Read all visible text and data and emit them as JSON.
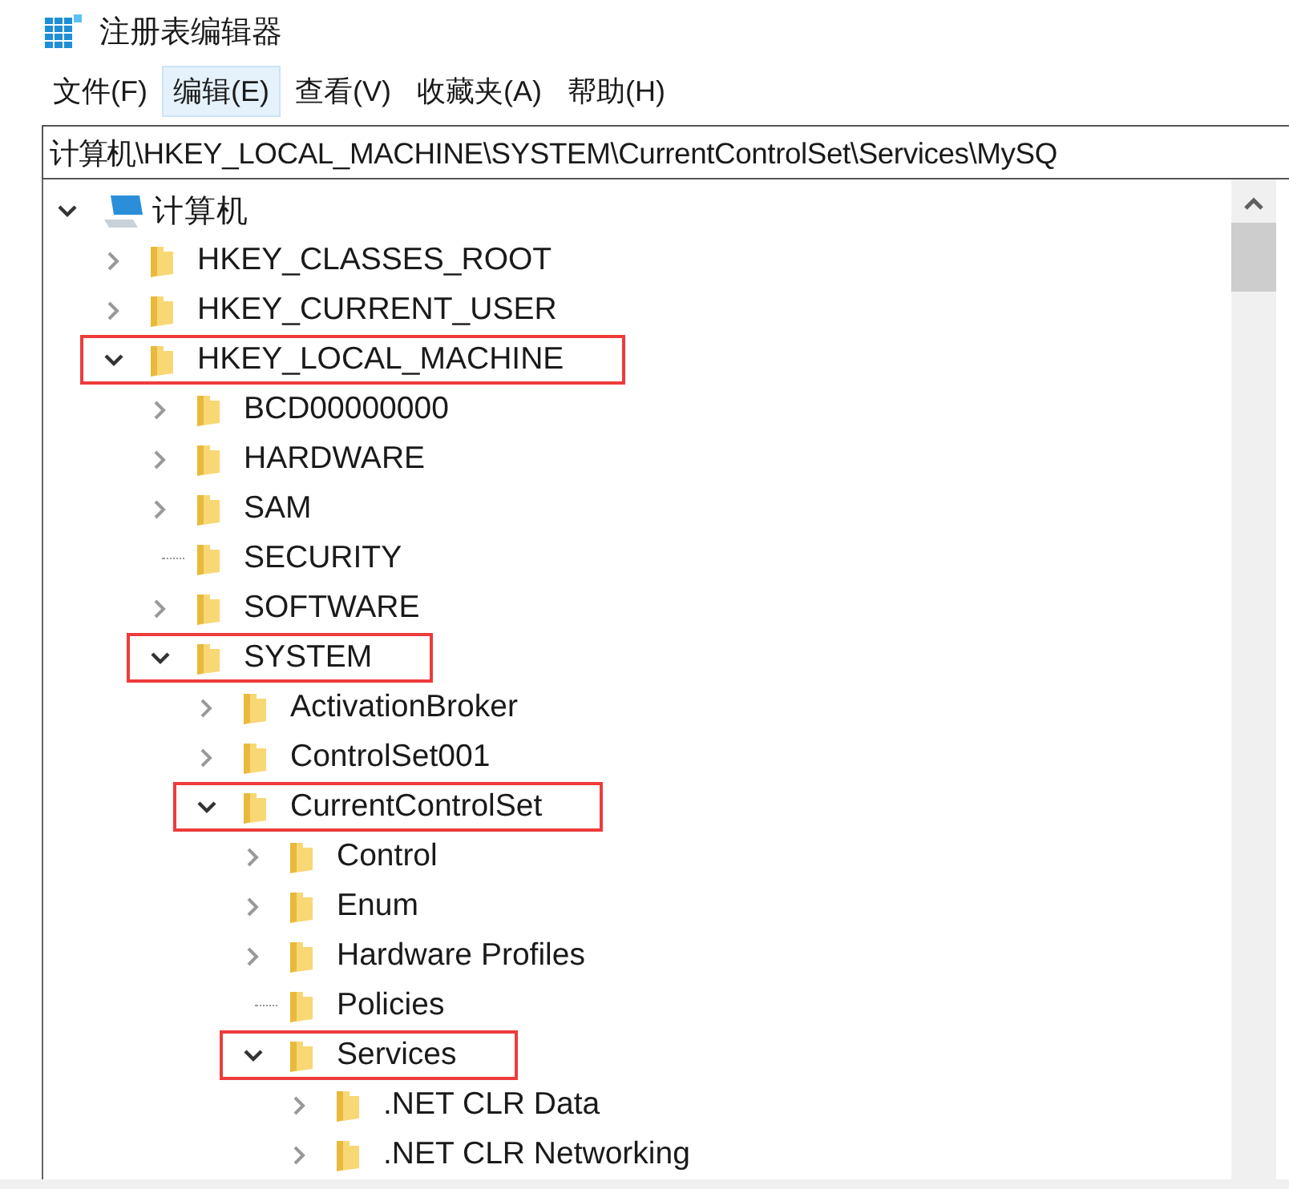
{
  "window": {
    "title": "注册表编辑器"
  },
  "menu": [
    {
      "label": "文件(F)",
      "selected": false
    },
    {
      "label": "编辑(E)",
      "selected": true
    },
    {
      "label": "查看(V)",
      "selected": false
    },
    {
      "label": "收藏夹(A)",
      "selected": false
    },
    {
      "label": "帮助(H)",
      "selected": false
    }
  ],
  "address": {
    "value": "计算机\\HKEY_LOCAL_MACHINE\\SYSTEM\\CurrentControlSet\\Services\\MySQ"
  },
  "tree": {
    "label": "计算机",
    "kind": "computer",
    "expandable": true,
    "expanded": true,
    "highlighted": false,
    "children": [
      {
        "label": "HKEY_CLASSES_ROOT",
        "kind": "folder",
        "expandable": true,
        "expanded": false,
        "highlighted": false
      },
      {
        "label": "HKEY_CURRENT_USER",
        "kind": "folder",
        "expandable": true,
        "expanded": false,
        "highlighted": false
      },
      {
        "label": "HKEY_LOCAL_MACHINE",
        "kind": "folder",
        "expandable": true,
        "expanded": true,
        "highlighted": true,
        "children": [
          {
            "label": "BCD00000000",
            "kind": "folder",
            "expandable": true,
            "expanded": false,
            "highlighted": false
          },
          {
            "label": "HARDWARE",
            "kind": "folder",
            "expandable": true,
            "expanded": false,
            "highlighted": false
          },
          {
            "label": "SAM",
            "kind": "folder",
            "expandable": true,
            "expanded": false,
            "highlighted": false
          },
          {
            "label": "SECURITY",
            "kind": "folder",
            "expandable": false,
            "expanded": false,
            "highlighted": false
          },
          {
            "label": "SOFTWARE",
            "kind": "folder",
            "expandable": true,
            "expanded": false,
            "highlighted": false
          },
          {
            "label": "SYSTEM",
            "kind": "folder",
            "expandable": true,
            "expanded": true,
            "highlighted": true,
            "children": [
              {
                "label": "ActivationBroker",
                "kind": "folder",
                "expandable": true,
                "expanded": false,
                "highlighted": false
              },
              {
                "label": "ControlSet001",
                "kind": "folder",
                "expandable": true,
                "expanded": false,
                "highlighted": false
              },
              {
                "label": "CurrentControlSet",
                "kind": "folder",
                "expandable": true,
                "expanded": true,
                "highlighted": true,
                "children": [
                  {
                    "label": "Control",
                    "kind": "folder",
                    "expandable": true,
                    "expanded": false,
                    "highlighted": false
                  },
                  {
                    "label": "Enum",
                    "kind": "folder",
                    "expandable": true,
                    "expanded": false,
                    "highlighted": false
                  },
                  {
                    "label": "Hardware Profiles",
                    "kind": "folder",
                    "expandable": true,
                    "expanded": false,
                    "highlighted": false
                  },
                  {
                    "label": "Policies",
                    "kind": "folder",
                    "expandable": false,
                    "expanded": false,
                    "highlighted": false
                  },
                  {
                    "label": "Services",
                    "kind": "folder",
                    "expandable": true,
                    "expanded": true,
                    "highlighted": true,
                    "children": [
                      {
                        "label": ".NET CLR Data",
                        "kind": "folder",
                        "expandable": true,
                        "expanded": false,
                        "highlighted": false
                      },
                      {
                        "label": ".NET CLR Networking",
                        "kind": "folder",
                        "expandable": true,
                        "expanded": false,
                        "highlighted": false
                      }
                    ]
                  }
                ]
              }
            ]
          }
        ]
      }
    ]
  }
}
